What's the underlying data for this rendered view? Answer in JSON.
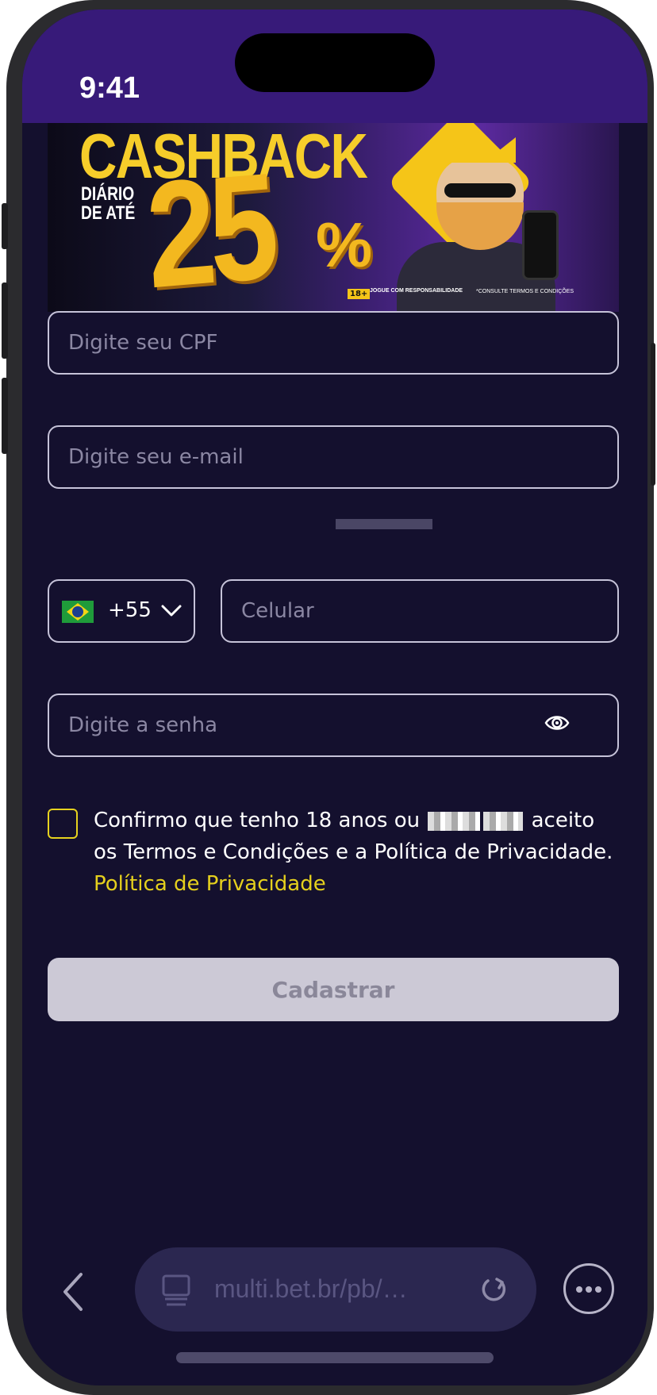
{
  "status_bar": {
    "time": "9:41"
  },
  "banner": {
    "title": "CASHBACK",
    "subtitle_line1": "DIÁRIO",
    "subtitle_line2": "DE ATÉ",
    "percent": "25",
    "percent_sign": "%",
    "age_badge": "18+",
    "footer_left": "JOGUE COM RESPONSABILIDADE",
    "footer_right": "*CONSULTE TERMOS E CONDIÇÕES"
  },
  "form": {
    "cpf": {
      "placeholder": "Digite seu CPF",
      "value": ""
    },
    "email": {
      "placeholder": "Digite seu e-mail",
      "value": ""
    },
    "country": {
      "code": "+55",
      "flag": "brazil-flag"
    },
    "phone": {
      "placeholder": "Celular",
      "value": ""
    },
    "password": {
      "placeholder": "Digite a senha",
      "value": ""
    },
    "consent": {
      "text_before": "Confirmo que tenho 18 anos ou ",
      "text_after": " aceito os Termos e Condições e a Política de Privacidade. ",
      "link": "Política de Privacidade",
      "checked": false
    },
    "submit_label": "Cadastrar"
  },
  "browser": {
    "url": "multi.bet.br/pb/…"
  },
  "colors": {
    "status_bar": "#371a79",
    "background": "#14102e",
    "accent_link": "#e5d01d",
    "field_border": "#c6c3d9"
  }
}
